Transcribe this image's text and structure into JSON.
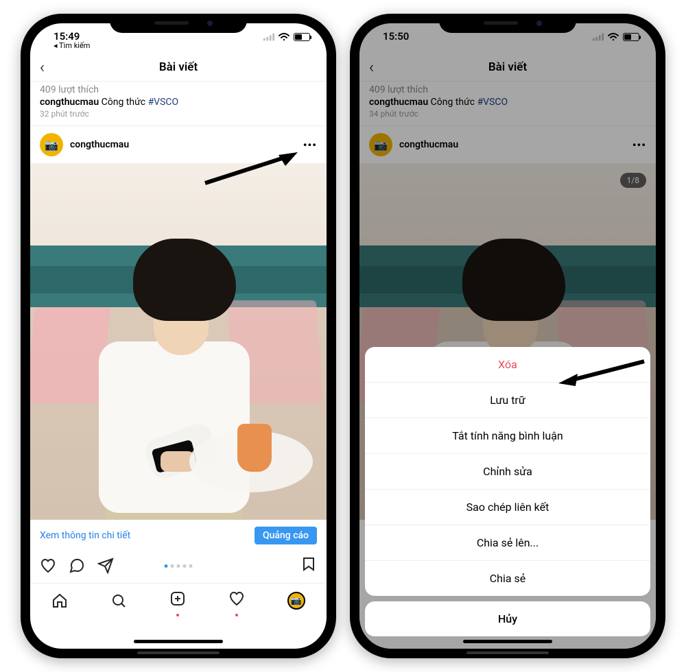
{
  "left": {
    "status": {
      "time": "15:49",
      "back_search": "Tìm kiếm"
    },
    "header": {
      "title": "Bài viết"
    },
    "prev_post": {
      "likes": "409 lượt thích",
      "username": "congthucmau",
      "caption": "Công thức",
      "hashtag": "#VSCO",
      "time": "32 phút trước"
    },
    "post": {
      "username": "congthucmau"
    },
    "info": {
      "link": "Xem thông tin chi tiết",
      "ad_button": "Quảng cáo"
    }
  },
  "right": {
    "status": {
      "time": "15:50"
    },
    "header": {
      "title": "Bài viết"
    },
    "prev_post": {
      "likes": "409 lượt thích",
      "username": "congthucmau",
      "caption": "Công thức",
      "hashtag": "#VSCO",
      "time": "34 phút trước"
    },
    "post": {
      "username": "congthucmau",
      "pager": "1/8"
    },
    "sheet": {
      "items": [
        {
          "label": "Xóa",
          "destructive": true
        },
        {
          "label": "Lưu trữ"
        },
        {
          "label": "Tắt tính năng bình luận"
        },
        {
          "label": "Chỉnh sửa"
        },
        {
          "label": "Sao chép liên kết"
        },
        {
          "label": "Chia sẻ lên..."
        },
        {
          "label": "Chia sẻ"
        }
      ],
      "cancel": "Hủy"
    }
  }
}
